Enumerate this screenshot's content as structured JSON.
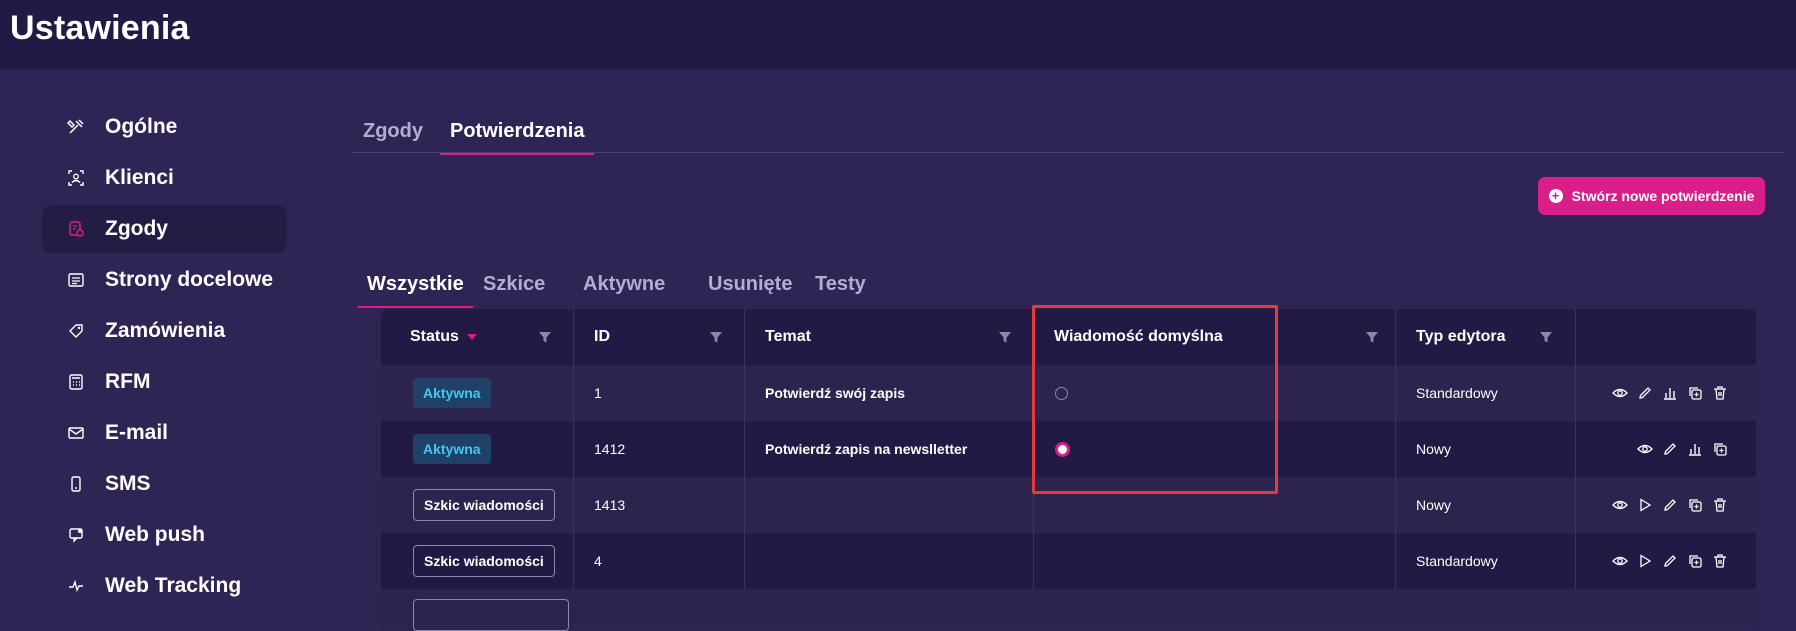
{
  "header": {
    "title": "Ustawienia"
  },
  "sidebar": {
    "items": [
      {
        "label": "Ogólne",
        "icon": "tools-icon"
      },
      {
        "label": "Klienci",
        "icon": "user-id-icon"
      },
      {
        "label": "Zgody",
        "icon": "consent-icon",
        "active": true
      },
      {
        "label": "Strony docelowe",
        "icon": "landing-page-icon"
      },
      {
        "label": "Zamówienia",
        "icon": "tag-icon"
      },
      {
        "label": "RFM",
        "icon": "calculator-icon"
      },
      {
        "label": "E-mail",
        "icon": "envelope-icon"
      },
      {
        "label": "SMS",
        "icon": "phone-icon"
      },
      {
        "label": "Web push",
        "icon": "push-icon"
      },
      {
        "label": "Web Tracking",
        "icon": "tracking-icon"
      }
    ]
  },
  "main": {
    "tabs": [
      {
        "label": "Zgody"
      },
      {
        "label": "Potwierdzenia",
        "active": true
      }
    ],
    "create_button": "Stwórz nowe potwierdzenie",
    "subtabs": [
      {
        "label": "Wszystkie",
        "active": true
      },
      {
        "label": "Szkice"
      },
      {
        "label": "Aktywne"
      },
      {
        "label": "Usunięte"
      },
      {
        "label": "Testy"
      }
    ],
    "table": {
      "columns": [
        "Status",
        "ID",
        "Temat",
        "Wiadomość domyślna",
        "Typ edytora"
      ],
      "rows": [
        {
          "status": "Aktywna",
          "status_type": "active",
          "id": "1",
          "topic": "Potwierdź swój zapis",
          "default": false,
          "editor": "Standardowy",
          "actions": [
            "eye-icon",
            "edit-icon",
            "stats-icon",
            "copy-icon",
            "trash-icon"
          ]
        },
        {
          "status": "Aktywna",
          "status_type": "active",
          "id": "1412",
          "topic": "Potwierdź zapis na newslletter",
          "default": true,
          "editor": "Nowy",
          "actions": [
            "eye-icon",
            "edit-icon",
            "stats-icon",
            "copy-icon"
          ]
        },
        {
          "status": "Szkic wiadomości",
          "status_type": "draft",
          "id": "1413",
          "topic": "",
          "editor": "Nowy",
          "actions": [
            "eye-icon",
            "play-icon",
            "edit-icon",
            "copy-icon",
            "trash-icon"
          ]
        },
        {
          "status": "Szkic wiadomości",
          "status_type": "draft",
          "id": "4",
          "topic": "",
          "editor": "Standardowy",
          "actions": [
            "eye-icon",
            "play-icon",
            "edit-icon",
            "copy-icon",
            "trash-icon"
          ]
        }
      ]
    }
  },
  "colors": {
    "accent": "#d91e8a",
    "background": "#2f2555",
    "header": "#211a44",
    "highlight": "#e53a3e",
    "active_badge": "#47c6f0"
  }
}
